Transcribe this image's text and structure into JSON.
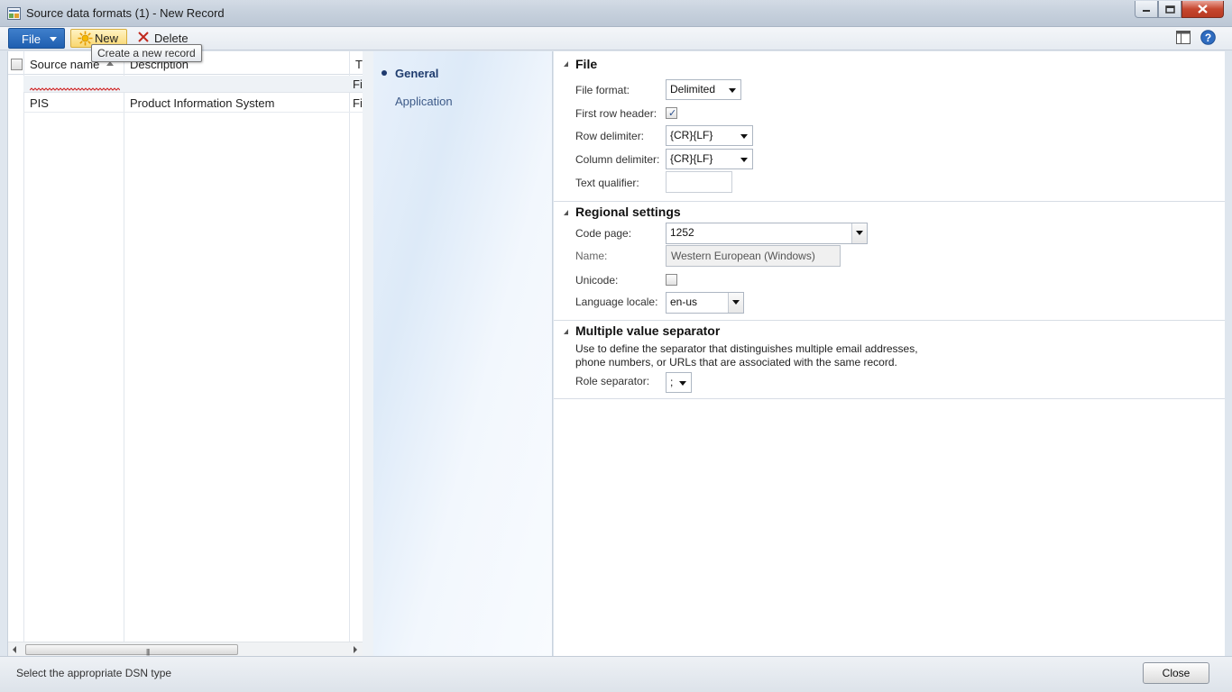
{
  "window": {
    "title": "Source data formats (1) - New Record"
  },
  "toolbar": {
    "file_label": "File",
    "new_label": "New",
    "delete_label": "Delete",
    "tooltip": "Create a new record"
  },
  "grid": {
    "columns": [
      "Source name",
      "Description",
      "T"
    ],
    "filter_row": {
      "type": "Fil"
    },
    "rows": [
      {
        "source_name": "PIS",
        "description": "Product Information System",
        "type": "Fil"
      }
    ]
  },
  "nav": {
    "items": [
      {
        "label": "General",
        "selected": true
      },
      {
        "label": "Application",
        "selected": false
      }
    ]
  },
  "groups": {
    "file": {
      "title": "File",
      "file_format_label": "File format:",
      "file_format_value": "Delimited",
      "first_row_header_label": "First row header:",
      "first_row_header_checked": true,
      "row_delimiter_label": "Row delimiter:",
      "row_delimiter_value": "{CR}{LF}",
      "column_delimiter_label": "Column delimiter:",
      "column_delimiter_value": "{CR}{LF}",
      "text_qualifier_label": "Text qualifier:",
      "text_qualifier_value": ""
    },
    "regional": {
      "title": "Regional settings",
      "code_page_label": "Code page:",
      "code_page_value": "1252",
      "name_label": "Name:",
      "name_value": "Western European (Windows)",
      "unicode_label": "Unicode:",
      "unicode_checked": false,
      "language_locale_label": "Language locale:",
      "language_locale_value": "en-us"
    },
    "mvs": {
      "title": "Multiple value separator",
      "description_line1": "Use to define the separator that distinguishes multiple email addresses,",
      "description_line2": "phone numbers, or URLs that are associated with the same record.",
      "role_separator_label": "Role separator:",
      "role_separator_value": ";"
    }
  },
  "status": {
    "text": "Select the appropriate DSN type",
    "close_label": "Close"
  },
  "colors": {
    "file_button": "#2a6bbd",
    "new_button": "#f9d770",
    "nav_selected": "#1f3c6e",
    "close_window": "#c6472f"
  }
}
